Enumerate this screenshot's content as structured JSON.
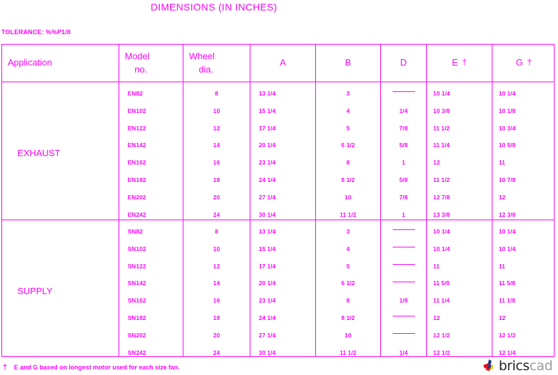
{
  "title": "DIMENSIONS (IN INCHES)",
  "tolerance": "TOLERANCE: %%P1/8",
  "accent_color": "#ff00ff",
  "footnote": {
    "symbol": "†",
    "text": "E and G based on longest motor used for each size fan."
  },
  "logo": {
    "brics": "brics",
    "cad": "cad"
  },
  "table": {
    "headers": {
      "application": "Application",
      "model_line1": "Model",
      "model_line2": "no.",
      "wheel_line1": "Wheel",
      "wheel_line2": "dia.",
      "a": "A",
      "b": "B",
      "d": "D",
      "e": "E",
      "e_dagger": "†",
      "g": "G",
      "g_dagger": "†"
    },
    "sections": [
      {
        "application": "EXHAUST",
        "rows": [
          {
            "model": "EN82",
            "wheel": "8",
            "a": "13 1/4",
            "b": "3",
            "d": "—",
            "e": "10 1/4",
            "g": "10 1/4"
          },
          {
            "model": "EN102",
            "wheel": "10",
            "a": "15 1/4",
            "b": "4",
            "d": "1/4",
            "e": "10 3/8",
            "g": "10 1/8"
          },
          {
            "model": "EN122",
            "wheel": "12",
            "a": "17 1/4",
            "b": "5",
            "d": "7/8",
            "e": "11 1/2",
            "g": "10 3/4"
          },
          {
            "model": "EN142",
            "wheel": "14",
            "a": "20 1/4",
            "b": "6 1/2",
            "d": "5/8",
            "e": "11 1/4",
            "g": "10 5/8"
          },
          {
            "model": "EN162",
            "wheel": "16",
            "a": "23 1/4",
            "b": "8",
            "d": "1",
            "e": "12",
            "g": "11"
          },
          {
            "model": "EN182",
            "wheel": "18",
            "a": "24 1/4",
            "b": "8 1/2",
            "d": "5/8",
            "e": "11 1/2",
            "g": "10 7/8"
          },
          {
            "model": "EN202",
            "wheel": "20",
            "a": "27 1/4",
            "b": "10",
            "d": "7/8",
            "e": "12 7/8",
            "g": "12"
          },
          {
            "model": "EN242",
            "wheel": "24",
            "a": "30 1/4",
            "b": "11 1/2",
            "d": "1",
            "e": "13 3/8",
            "g": "12 3/8"
          }
        ]
      },
      {
        "application": "SUPPLY",
        "rows": [
          {
            "model": "SN82",
            "wheel": "8",
            "a": "13 1/4",
            "b": "3",
            "d": "—",
            "e": "10 1/4",
            "g": "10 1/4"
          },
          {
            "model": "SN102",
            "wheel": "10",
            "a": "15 1/4",
            "b": "4",
            "d": "—",
            "e": "10 1/4",
            "g": "10 1/4"
          },
          {
            "model": "SN122",
            "wheel": "12",
            "a": "17 1/4",
            "b": "5",
            "d": "—",
            "e": "11",
            "g": "11"
          },
          {
            "model": "SN142",
            "wheel": "14",
            "a": "20 1/4",
            "b": "6 1/2",
            "d": "—",
            "e": "11 5/8",
            "g": "11 5/8"
          },
          {
            "model": "SN162",
            "wheel": "16",
            "a": "23 1/4",
            "b": "8",
            "d": "1/8",
            "e": "11 1/4",
            "g": "11 1/8"
          },
          {
            "model": "SN182",
            "wheel": "18",
            "a": "24 1/4",
            "b": "8 1/2",
            "d": "—",
            "e": "12",
            "g": "12"
          },
          {
            "model": "SN202",
            "wheel": "20",
            "a": "27 1/4",
            "b": "10",
            "d": "—",
            "e": "12 1/2",
            "g": "12 1/2"
          },
          {
            "model": "SN242",
            "wheel": "24",
            "a": "30 1/4",
            "b": "11 1/2",
            "d": "1/4",
            "e": "12 1/2",
            "g": "12 1/4"
          }
        ]
      }
    ]
  }
}
